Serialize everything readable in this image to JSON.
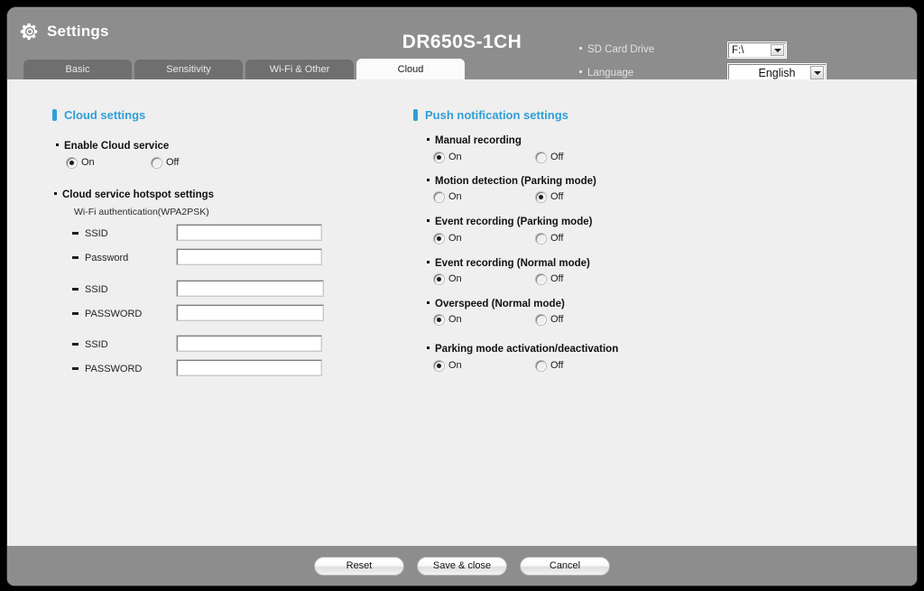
{
  "window": {
    "app_title": "Settings",
    "model_title": "DR650S-1CH",
    "gear_icon": "gear-icon"
  },
  "header": {
    "sd_card": {
      "label": "SD Card Drive",
      "value": "F:\\",
      "arrow_icon": "chevron-down-icon"
    },
    "language": {
      "label": "Language",
      "value": "English",
      "arrow_icon": "chevron-down-icon"
    }
  },
  "tabs": [
    {
      "label": "Basic",
      "active": false
    },
    {
      "label": "Sensitivity",
      "active": false
    },
    {
      "label": "Wi-Fi & Other",
      "active": false
    },
    {
      "label": "Cloud",
      "active": true
    }
  ],
  "cloud": {
    "section_title": "Cloud settings",
    "enable_cloud": {
      "label": "Enable Cloud service",
      "on_label": "On",
      "off_label": "Off",
      "selected": "On"
    },
    "hotspot": {
      "label": "Cloud service hotspot settings",
      "auth_note": "Wi-Fi authentication(WPA2PSK)",
      "groups": [
        {
          "ssid_label": "SSID",
          "ssid_value": "",
          "password_label": "Password",
          "password_value": ""
        },
        {
          "ssid_label": "SSID",
          "ssid_value": "",
          "password_label": "PASSWORD",
          "password_value": ""
        },
        {
          "ssid_label": "SSID",
          "ssid_value": "",
          "password_label": "PASSWORD",
          "password_value": ""
        }
      ]
    }
  },
  "push": {
    "section_title": "Push notification settings",
    "items": [
      {
        "label": "Manual recording",
        "on_label": "On",
        "off_label": "Off",
        "selected": "On"
      },
      {
        "label": "Motion detection (Parking mode)",
        "on_label": "On",
        "off_label": "Off",
        "selected": "Off"
      },
      {
        "label": "Event recording (Parking mode)",
        "on_label": "On",
        "off_label": "Off",
        "selected": "On"
      },
      {
        "label": "Event recording (Normal mode)",
        "on_label": "On",
        "off_label": "Off",
        "selected": "On"
      },
      {
        "label": "Overspeed (Normal mode)",
        "on_label": "On",
        "off_label": "Off",
        "selected": "On"
      },
      {
        "label": "Parking mode activation/deactivation",
        "on_label": "On",
        "off_label": "Off",
        "selected": "On"
      }
    ]
  },
  "footer": {
    "reset_label": "Reset",
    "save_label": "Save & close",
    "cancel_label": "Cancel"
  },
  "colors": {
    "header_bar": "#8d8d8d",
    "content_bg": "#efefef",
    "accent_blue": "#2f9fd6",
    "tab_inactive": "#6f6f6f",
    "tab_active": "#fbfbfb"
  }
}
